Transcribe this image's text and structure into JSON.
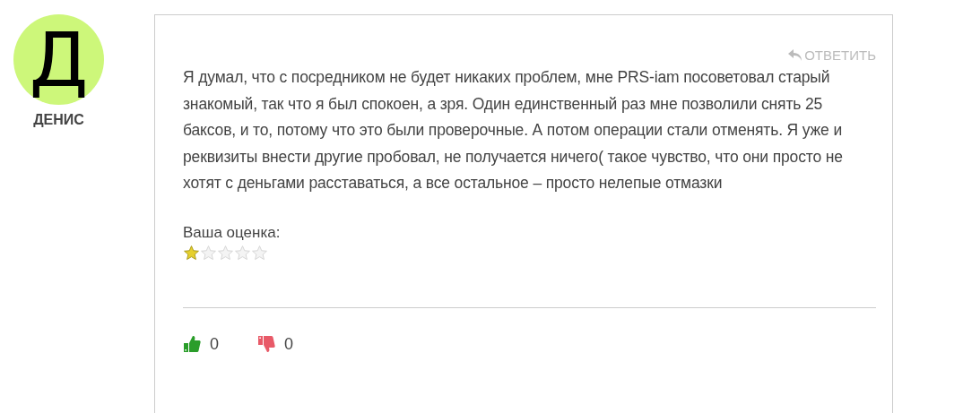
{
  "author": {
    "initial": "Д",
    "name": "ДЕНИС"
  },
  "reply_link": "ОТВЕТИТЬ",
  "text": "Я думал, что с посредником не будет никаких проблем, мне PRS-iam посоветовал старый знакомый, так что я был спокоен, а зря. Один единственный раз мне позволили снять 25 баксов, и то, потому что это были проверочные. А потом операции стали отменять. Я уже и реквизиты внести другие пробовал, не получается ничего( такое чувство, что они просто не хотят с деньгами расставаться, а все остальное – просто нелепые отмазки",
  "rating": {
    "label": "Ваша оценка:",
    "stars": 1
  },
  "votes": {
    "likes": "0",
    "dislikes": "0"
  }
}
